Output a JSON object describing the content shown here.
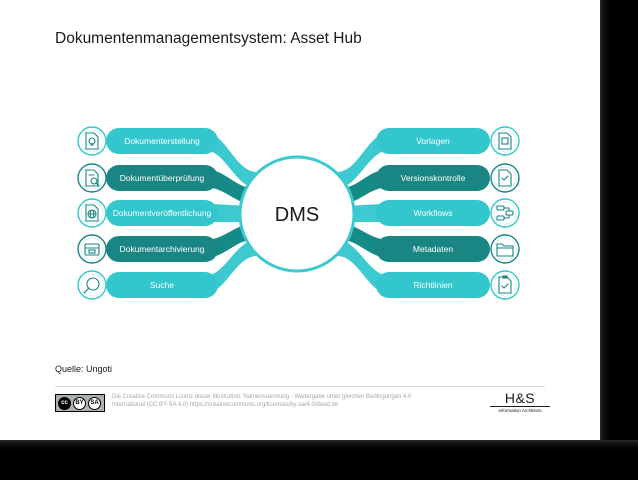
{
  "title": "Dokumentenmanagementsystem: Asset Hub",
  "center_label": "DMS",
  "left_items": [
    {
      "label": "Dokumenterstellung",
      "icon": "document-lightbulb-icon"
    },
    {
      "label": "Dokumentüberprüfung",
      "icon": "document-magnifier-icon"
    },
    {
      "label": "Dokumentveröffentlichung",
      "icon": "document-globe-icon"
    },
    {
      "label": "Dokumentarchivierung",
      "icon": "archive-box-icon"
    },
    {
      "label": "Suche",
      "icon": "search-icon"
    }
  ],
  "right_items": [
    {
      "label": "Vorlagen",
      "icon": "template-icon"
    },
    {
      "label": "Versionskontrolle",
      "icon": "version-control-icon"
    },
    {
      "label": "Workflows",
      "icon": "workflow-icon"
    },
    {
      "label": "Metadaten",
      "icon": "folder-metadata-icon"
    },
    {
      "label": "Richtlinien",
      "icon": "clipboard-check-icon"
    }
  ],
  "colors": {
    "light": "#33c6cc",
    "dark": "#1a8684",
    "band_light": "#3cc9cf",
    "band_dark": "#168a86"
  },
  "source": "Quelle: Ungoti",
  "license_text": "Die Creative Commons Lizenz dieser Illustration: Namensnennung - Weitergabe unter gleichen Bedingungen 4.0 International (CC BY-SA 4.0) https://creativecommons.org/licenses/by-sa/4.0/deed.de",
  "cc_badge": {
    "cc": "cc",
    "by": "BY",
    "sa": "SA"
  },
  "logo": {
    "main": "H&S",
    "sub": "Information Architects"
  }
}
